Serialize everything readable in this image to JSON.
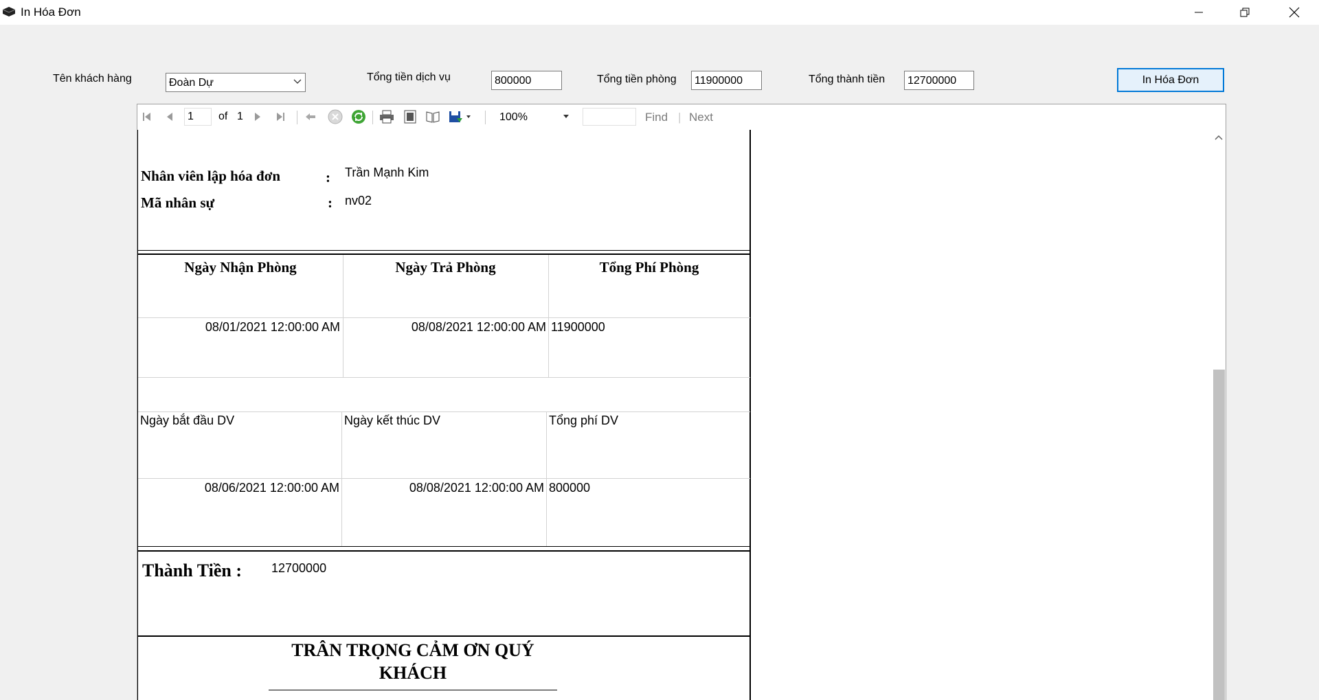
{
  "window": {
    "title": "In Hóa Đơn",
    "min_icon": "minimize-icon",
    "max_icon": "restore-icon",
    "close_icon": "close-icon"
  },
  "form": {
    "customer_label": "Tên khách hàng",
    "customer_value": "Đoàn Dự",
    "service_total_label": "Tổng tiền dịch vụ",
    "service_total_value": "800000",
    "room_total_label": "Tổng tiền phòng",
    "room_total_value": "11900000",
    "grand_total_label": "Tổng thành tiền",
    "grand_total_value": "12700000",
    "print_button": "In Hóa Đơn"
  },
  "toolbar": {
    "page_current": "1",
    "page_of": "of",
    "page_total": "1",
    "zoom": "100%",
    "find": "Find",
    "separator": "|",
    "next": "Next"
  },
  "report": {
    "employee_label": "Nhân viên lập hóa đơn",
    "employee_colon": ":",
    "employee_value": "Trần Mạnh Kim",
    "staff_id_label": "Mã nhân sự",
    "staff_id_colon": ":",
    "staff_id_value": "nv02",
    "room_headers": [
      "Ngày Nhận Phòng",
      "Ngày Trả Phòng",
      "Tổng Phí Phòng"
    ],
    "room_row": [
      "08/01/2021 12:00:00 AM",
      "08/08/2021 12:00:00 AM",
      "11900000"
    ],
    "service_headers": [
      "Ngày bắt đầu  DV",
      "Ngày kết thúc DV",
      "Tổng phí DV"
    ],
    "service_row": [
      "08/06/2021 12:00:00 AM",
      "08/08/2021 12:00:00 AM",
      "800000"
    ],
    "total_label": "Thành Tiền :",
    "total_value": "12700000",
    "thanks_line1": "TRÂN TRỌNG CẢM ƠN QUÝ",
    "thanks_line2": "KHÁCH"
  }
}
